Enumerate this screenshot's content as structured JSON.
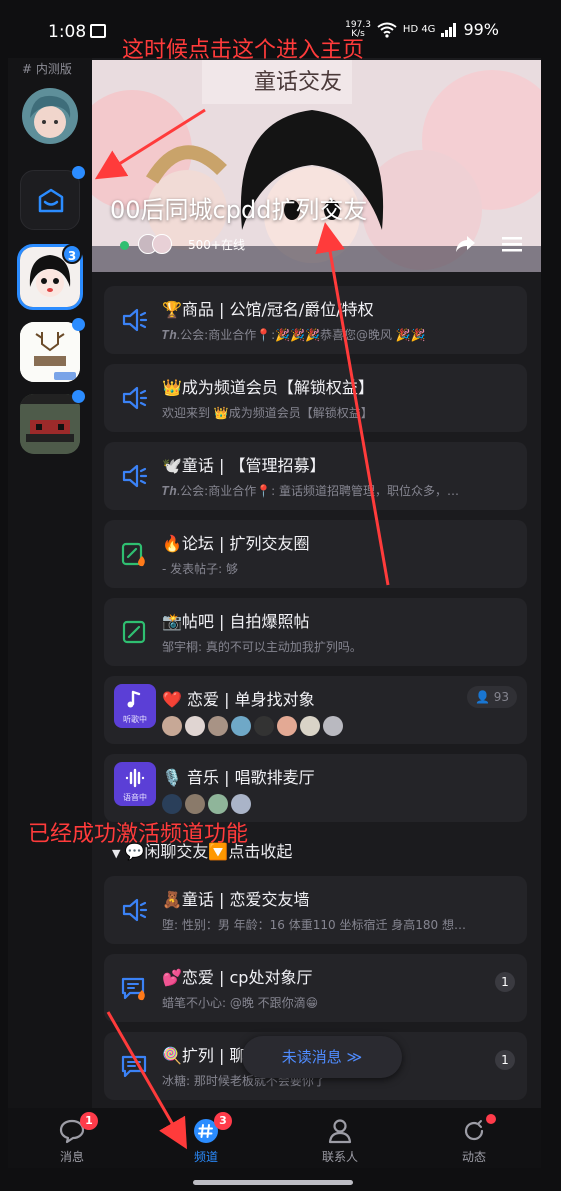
{
  "status": {
    "time": "1:08",
    "speed": "197.3",
    "speed_unit": "K/s",
    "network": "HD 4G",
    "battery": "99%"
  },
  "rail": {
    "beta_label": "# 内测版",
    "server_badge": "3"
  },
  "banner": {
    "logo_text": "童话交友",
    "title": "00后同城cpdd扩列交友",
    "online": "500+在线"
  },
  "channels": [
    {
      "title": "🏆商品 | 公馆/冠名/爵位/特权",
      "subtitle": "𝑻𝒉.公会:商业合作📍:🎉🎉🎉恭喜您@晚风 🎉🎉",
      "type": "voice"
    },
    {
      "title": "👑成为频道会员【解锁权益】",
      "subtitle": "欢迎来到 👑成为频道会员【解锁权益】",
      "type": "voice"
    },
    {
      "title": "🕊️童话 | 【管理招募】",
      "subtitle": "𝑻𝒉.公会:商业合作📍: 童话频道招聘管理，职位众多，…",
      "type": "voice"
    },
    {
      "title": "🔥论坛 | 扩列交友圈",
      "subtitle": "- 发表帖子: 够",
      "type": "forum-hot"
    },
    {
      "title": "📸帖吧 | 自拍爆照帖",
      "subtitle": "邹宇桐: 真的不可以主动加我扩列吗。",
      "type": "forum"
    },
    {
      "title": "❤️ 恋爱 | 单身找对象",
      "voice_label": "听歌中",
      "count_pill": "93",
      "type": "live-music"
    },
    {
      "title": "🎙️ 音乐 | 唱歌排麦厅",
      "voice_label": "语音中",
      "type": "live-voice"
    }
  ],
  "section_title": "💬闲聊交友🔽点击收起",
  "channels2": [
    {
      "title": "🧸童话 | 恋爱交友墙",
      "subtitle": "堕: 性别：男 年龄：16 体重110 坐标宿迁 身高180 想…",
      "type": "voice"
    },
    {
      "title": "💕恋爱 | cp处对象厅",
      "subtitle": "蜡笔不小心: @晚 不跟你滴😁",
      "count": "1",
      "type": "chat-hot"
    },
    {
      "title": "🍭扩列 | 聊",
      "subtitle": "冰糖: 那时候老板就不会要你了",
      "count": "1",
      "type": "chat"
    }
  ],
  "unread_label": "未读消息 ≫",
  "nav": [
    {
      "label": "消息",
      "badge": "1"
    },
    {
      "label": "频道",
      "badge": "3"
    },
    {
      "label": "联系人"
    },
    {
      "label": "动态"
    }
  ],
  "annotations": {
    "top": "这时候点击这个进入主页",
    "middle": "已经成功激活频道功能"
  },
  "colors": {
    "accent": "#2b8cff",
    "annotation": "#ff3b3b",
    "badge_red": "#ff3b4a",
    "voice_purple": "#5b3fd6",
    "forum_green": "#2fbf71",
    "channel_blue": "#3b82f6"
  }
}
